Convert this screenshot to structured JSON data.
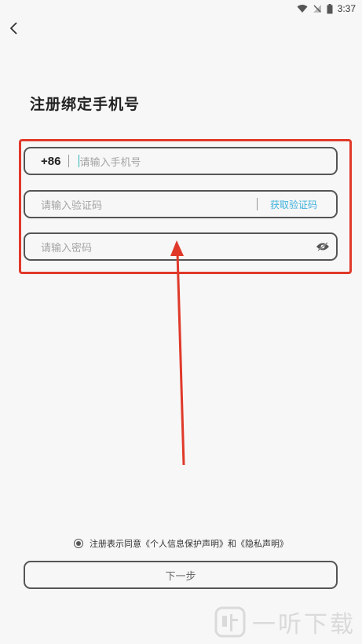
{
  "status_bar": {
    "time": "3:37"
  },
  "page": {
    "title": "注册绑定手机号"
  },
  "form": {
    "phone": {
      "country_code": "+86",
      "placeholder": "请输入手机号"
    },
    "code": {
      "placeholder": "请输入验证码",
      "get_code_label": "获取验证码"
    },
    "password": {
      "placeholder": "请输入密码"
    }
  },
  "agreement": {
    "text": "注册表示同意《个人信息保护声明》和《隐私声明》"
  },
  "next_button": {
    "label": "下一步"
  },
  "watermark": {
    "text": "一听下载"
  },
  "colors": {
    "annotation": "#e0392a",
    "link": "#3fb0dc",
    "cursor": "#2bb3b8"
  },
  "icons": [
    "wifi-icon",
    "signal-icon",
    "battery-icon",
    "back-icon",
    "eye-off-icon",
    "radio-checked-icon"
  ]
}
